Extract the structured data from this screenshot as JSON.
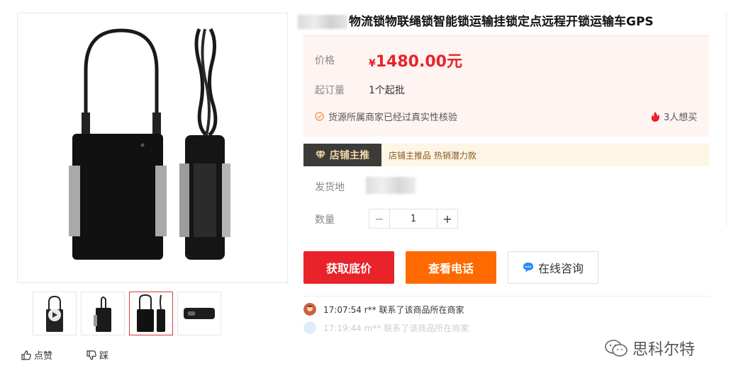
{
  "product": {
    "title": "物流锁物联绳锁智能锁运输挂锁定点远程开锁运输车GPS"
  },
  "price": {
    "label": "价格",
    "currency_symbol": "¥",
    "amount": "1480.00元",
    "moq_label": "起订量",
    "moq_value": "1个起批",
    "verify_text": "货源所属商家已经过真实性核验",
    "want_count": "3人想买"
  },
  "promo": {
    "tag_label": "店铺主推",
    "text": "店铺主推品 热销潜力款"
  },
  "shipping": {
    "label": "发货地"
  },
  "quantity": {
    "label": "数量",
    "minus": "−",
    "value": "1",
    "plus": "+"
  },
  "actions": {
    "get_price": "获取底价",
    "view_phone": "查看电话",
    "consult": "在线咨询"
  },
  "feed": [
    {
      "text": "17:07:54 r** 联系了该商品所在商家"
    },
    {
      "text": "17:19:44 m** 联系了该商品所在商家"
    }
  ],
  "social": {
    "like": "点赞",
    "dislike": "踩"
  },
  "watermark": "思科尔特",
  "colors": {
    "price_red": "#e8232a",
    "orange": "#ff6a00",
    "promo_dark": "#3d3b38",
    "promo_gold": "#f1d9a8"
  }
}
